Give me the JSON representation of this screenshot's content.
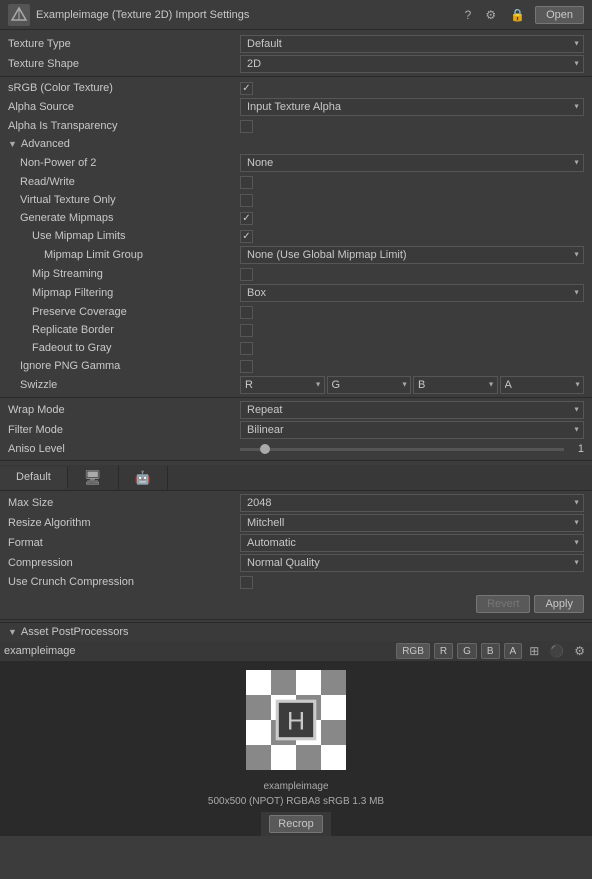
{
  "titleBar": {
    "title": "Exampleimage (Texture 2D) Import Settings",
    "openLabel": "Open",
    "helpIcon": "?",
    "settingsIcon": "⚙",
    "lockIcon": "☰"
  },
  "fields": {
    "textureType": {
      "label": "Texture Type",
      "value": "Default"
    },
    "textureShape": {
      "label": "Texture Shape",
      "value": "2D"
    },
    "sRGB": {
      "label": "sRGB (Color Texture)",
      "checked": true
    },
    "alphaSource": {
      "label": "Alpha Source",
      "value": "Input Texture Alpha"
    },
    "alphaIsTransparency": {
      "label": "Alpha Is Transparency",
      "checked": false
    }
  },
  "advanced": {
    "label": "Advanced",
    "nonPowerOf2": {
      "label": "Non-Power of 2",
      "value": "None"
    },
    "readWrite": {
      "label": "Read/Write",
      "checked": false
    },
    "virtualTextureOnly": {
      "label": "Virtual Texture Only",
      "checked": false
    },
    "generateMipmaps": {
      "label": "Generate Mipmaps",
      "checked": true
    },
    "useMipmapLimits": {
      "label": "Use Mipmap Limits",
      "checked": true
    },
    "mipmapLimitGroup": {
      "label": "Mipmap Limit Group",
      "value": "None (Use Global Mipmap Limit)"
    },
    "mipStreaming": {
      "label": "Mip Streaming",
      "checked": false
    },
    "mipmapFiltering": {
      "label": "Mipmap Filtering",
      "value": "Box"
    },
    "preserveCoverage": {
      "label": "Preserve Coverage",
      "checked": false
    },
    "replicateBorder": {
      "label": "Replicate Border",
      "checked": false
    },
    "fadeoutToGray": {
      "label": "Fadeout to Gray",
      "checked": false
    },
    "ignorePNGGamma": {
      "label": "Ignore PNG Gamma",
      "checked": false
    },
    "swizzle": {
      "label": "Swizzle",
      "r": "R",
      "g": "G",
      "b": "B",
      "a": "A"
    }
  },
  "wrapMode": {
    "label": "Wrap Mode",
    "value": "Repeat"
  },
  "filterMode": {
    "label": "Filter Mode",
    "value": "Bilinear"
  },
  "anisoLevel": {
    "label": "Aniso Level",
    "value": 1,
    "min": 0,
    "max": 16
  },
  "platform": {
    "defaultTab": "Default",
    "tabs": [
      "Default",
      "monitor",
      "android"
    ]
  },
  "platformSettings": {
    "maxSize": {
      "label": "Max Size",
      "value": "2048"
    },
    "resizeAlgorithm": {
      "label": "Resize Algorithm",
      "value": "Mitchell"
    },
    "format": {
      "label": "Format",
      "value": "Automatic"
    },
    "compression": {
      "label": "Compression",
      "value": "Normal Quality"
    },
    "useCrunchCompression": {
      "label": "Use Crunch Compression",
      "checked": false
    }
  },
  "buttons": {
    "revert": "Revert",
    "apply": "Apply"
  },
  "assetPostProcessors": {
    "label": "Asset PostProcessors"
  },
  "preview": {
    "name": "exampleimage",
    "rgbBtn": "RGB",
    "rBtn": "R",
    "gBtn": "G",
    "bBtn": "B",
    "aBtn": "A",
    "info": "500x500 (NPOT)  RGBA8 sRGB  1.3 MB"
  },
  "bottomBar": {
    "recropBtn": "Recrop"
  }
}
